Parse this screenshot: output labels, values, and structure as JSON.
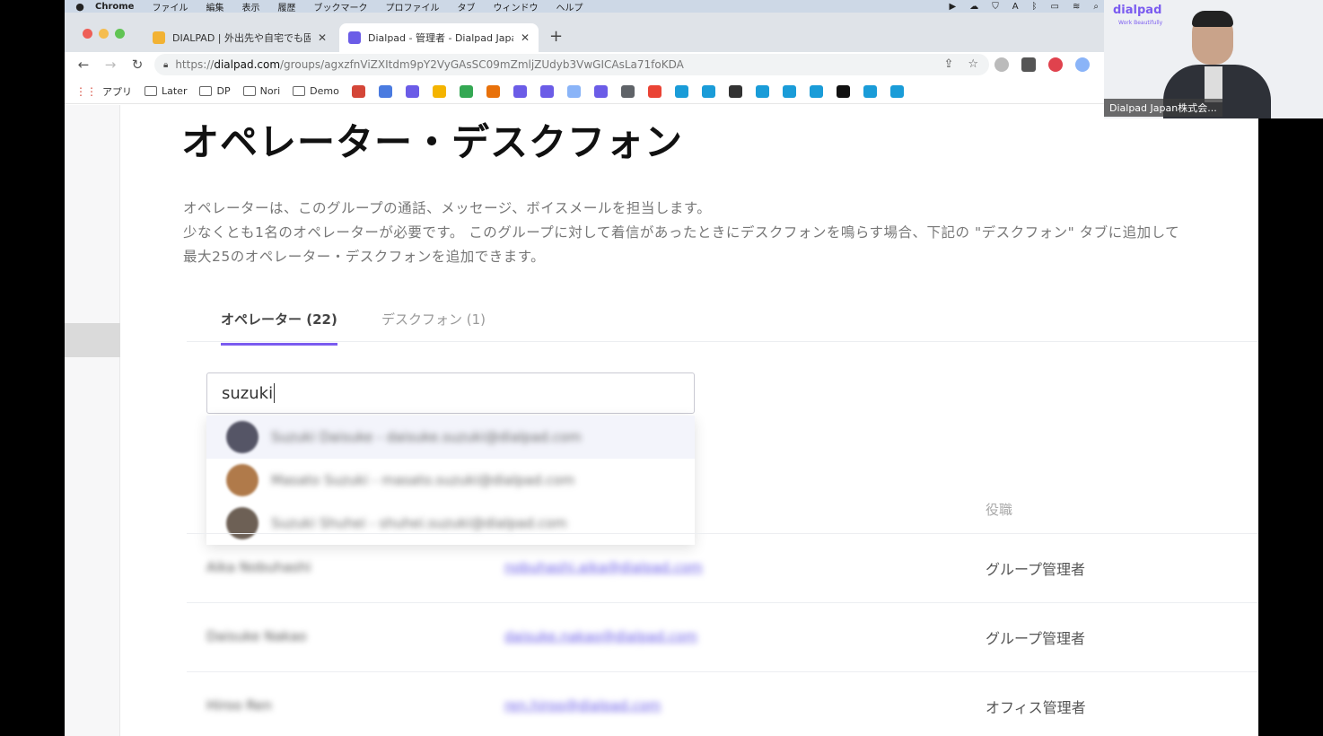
{
  "menubar": {
    "app": "Chrome",
    "items": [
      "ファイル",
      "編集",
      "表示",
      "履歴",
      "ブックマーク",
      "プロファイル",
      "タブ",
      "ウィンドウ",
      "ヘルプ"
    ]
  },
  "browser": {
    "tabs": [
      {
        "title": "DIALPAD | 外出先や自宅でも固定",
        "fav_color": "#f2b233"
      },
      {
        "title": "Dialpad - 管理者 - Dialpad Japa",
        "fav_color": "#6b5ce7"
      }
    ],
    "url_prefix": "https://",
    "url_host": "dialpad.com",
    "url_path": "/groups/agxzfnViZXItdm9pY2VyGAsSC09mZmljZUdyb3VwGICAsLa71foKDA",
    "bookmarks": [
      "アプリ",
      "Later",
      "DP",
      "Nori",
      "Demo"
    ],
    "bookmark_icon_colors": [
      "#d44638",
      "#4a7be0",
      "#6b5ce7",
      "#f4b400",
      "#34a853",
      "#e8710a",
      "#6b5ce7",
      "#6b5ce7",
      "#8ab4f8",
      "#6b5ce7",
      "#5f6368",
      "#ea4335",
      "#1a9cd8",
      "#1a9cd8",
      "#333333",
      "#1a9cd8",
      "#1a9cd8",
      "#1a9cd8",
      "#111111",
      "#1a9cd8",
      "#1a9cd8"
    ]
  },
  "page": {
    "title": "オペレーター・デスクフォン",
    "desc_line1": "オペレーターは、このグループの通話、メッセージ、ボイスメールを担当します。",
    "desc_line2": "少なくとも1名のオペレーターが必要です。 このグループに対して着信があったときにデスクフォンを鳴らす場合、下記の \"デスクフォン\" タブに追加して",
    "desc_line3": "最大25のオペレーター・デスクフォンを追加できます。",
    "tab_operators": "オペレーター (22)",
    "tab_deskphones": "デスクフォン (1)",
    "search_value": "suzuki",
    "suggestions": [
      "Suzuki Daisuke - daisuke.suzuki@dialpad.com",
      "Masato Suzuki - masato.suzuki@dialpad.com",
      "Suzuki Shuhei - shuhei.suzuki@dialpad.com"
    ],
    "col_role": "役職",
    "rows": [
      {
        "name": "Aika Nobuhashi",
        "email": "nobuhashi.aika@dialpad.com",
        "role": "グループ管理者"
      },
      {
        "name": "Daisuke Nakao",
        "email": "daisuke.nakao@dialpad.com",
        "role": "グループ管理者"
      },
      {
        "name": "Hiroo Ren",
        "email": "ren.hiroo@dialpad.com",
        "role": "オフィス管理者"
      }
    ]
  },
  "webcam": {
    "logo": "dialpad",
    "logo_sub": "Work Beautifully",
    "caption": "Dialpad Japan株式会..."
  }
}
